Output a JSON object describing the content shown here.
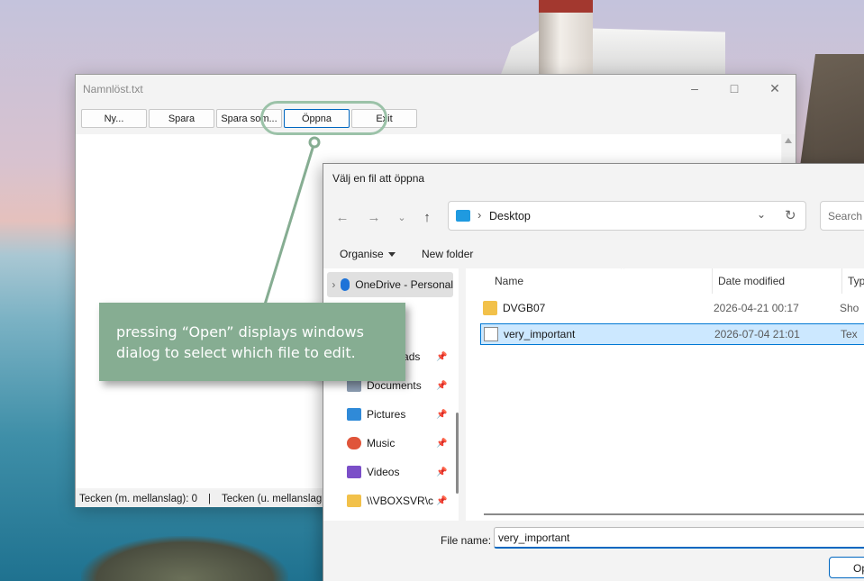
{
  "main_window": {
    "title": "Namnlöst.txt",
    "toolbar": [
      "Ny...",
      "Spara",
      "Spara som...",
      "Öppna",
      "Exit"
    ],
    "status": {
      "chars_with_spaces": "Tecken (m. mellanslag): 0",
      "separator": "|",
      "chars_without_spaces": "Tecken (u. mellanslag"
    }
  },
  "callout": {
    "text_line1": "pressing “Open” displays windows",
    "text_line2": "dialog to select which file to edit."
  },
  "dialog": {
    "title": "Välj en fil att öppna",
    "address": "Desktop",
    "search_placeholder": "Search D",
    "commands": {
      "organise": "Organise",
      "new_folder": "New folder"
    },
    "nav_items": [
      {
        "label": "OneDrive - Personal",
        "icon": "onedrive-icon",
        "color": "#1e73d8"
      },
      {
        "label": "Downloads",
        "icon": "downloads-icon",
        "color": "#2b7cd3"
      },
      {
        "label": "Documents",
        "icon": "documents-icon",
        "color": "#8a9bb0"
      },
      {
        "label": "Pictures",
        "icon": "pictures-icon",
        "color": "#2f8ad8"
      },
      {
        "label": "Music",
        "icon": "music-icon",
        "color": "#e0553a"
      },
      {
        "label": "Videos",
        "icon": "videos-icon",
        "color": "#7b4fc8"
      },
      {
        "label": "\\\\VBOXSVR\\c",
        "icon": "network-folder-icon",
        "color": "#f2c14a"
      }
    ],
    "columns": [
      "Name",
      "Date modified",
      "Typ"
    ],
    "files": [
      {
        "name": "DVGB07",
        "date": "2026-04-21 00:17",
        "type": "Sho",
        "icon": "folder-shortcut-icon"
      },
      {
        "name": "very_important",
        "date": "2026-07-04 21:01",
        "type": "Tex",
        "icon": "text-file-icon"
      }
    ],
    "file_name_label": "File name:",
    "file_name_value": "very_important",
    "open_button": "Op"
  },
  "colors": {
    "callout_bg": "#86ad92",
    "highlight": "#9bc2a8",
    "selection_bg": "#cce8ff",
    "selection_border": "#0078d4"
  }
}
